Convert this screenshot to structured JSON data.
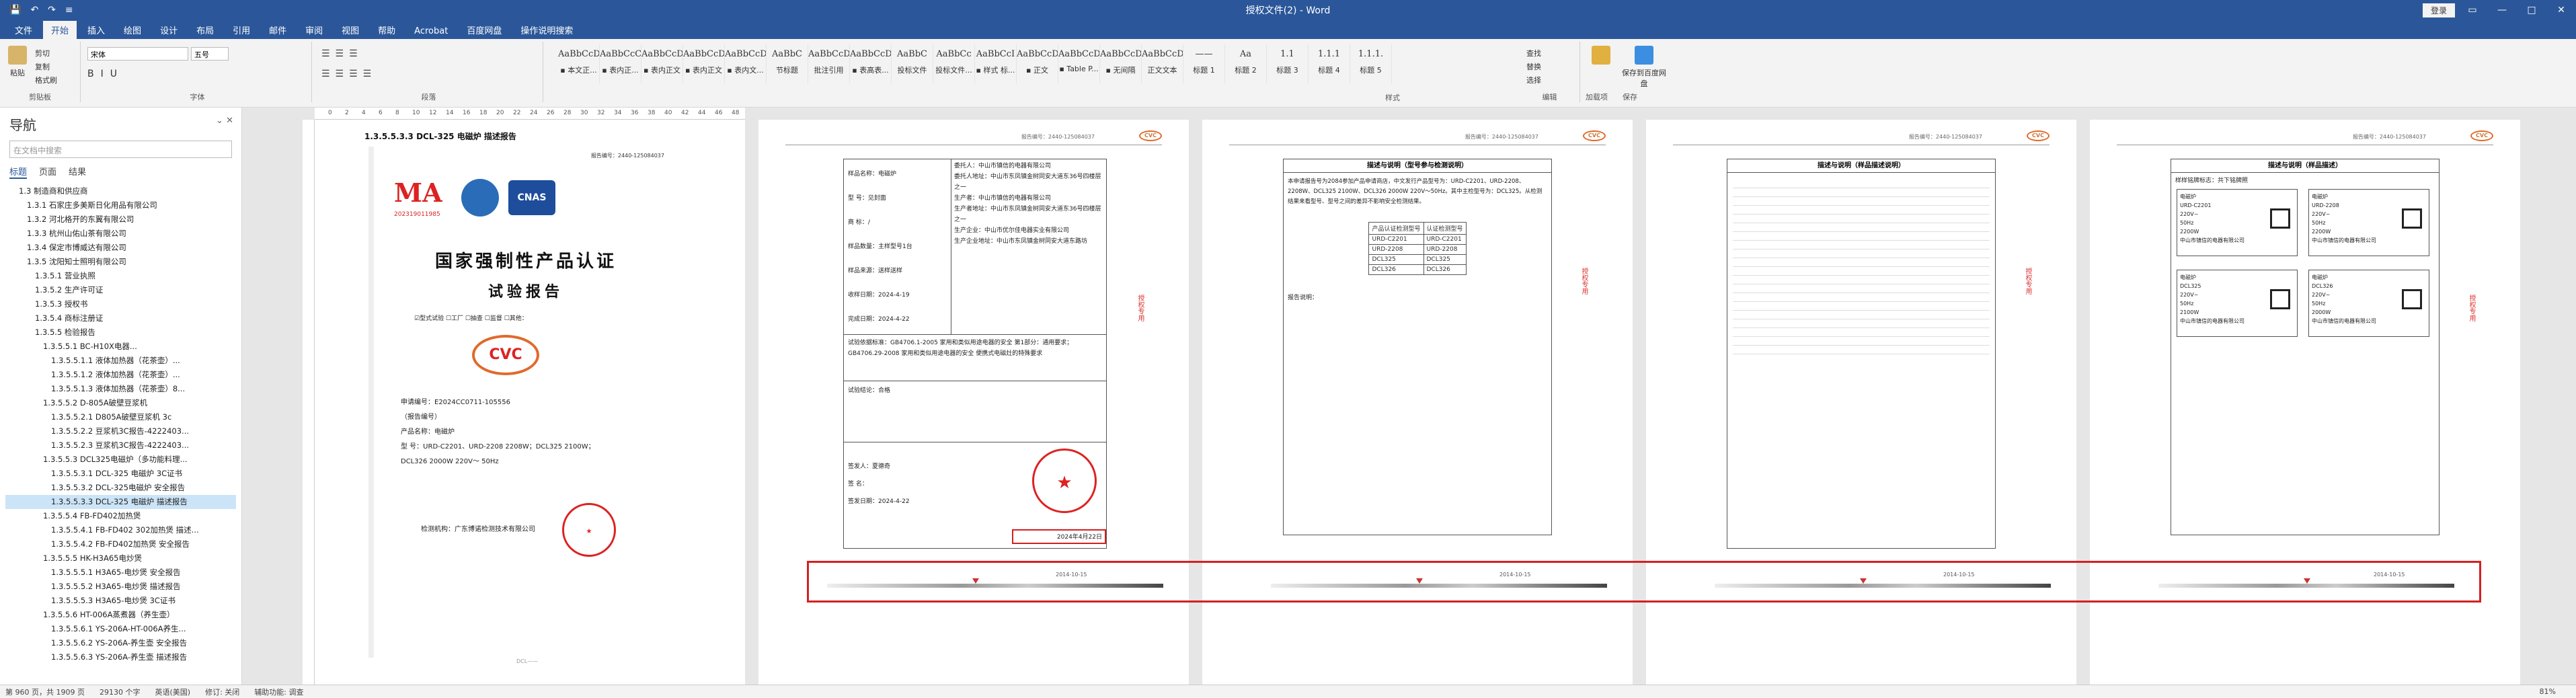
{
  "title_bar": {
    "quick_access": [
      "💾",
      "↶",
      "↷",
      "≡"
    ],
    "doc_title": "授权文件(2) - Word",
    "login": "登录",
    "win_buttons": [
      "▭",
      "—",
      "□",
      "✕"
    ]
  },
  "ribbon_tabs": [
    "文件",
    "开始",
    "插入",
    "绘图",
    "设计",
    "布局",
    "引用",
    "邮件",
    "审阅",
    "视图",
    "帮助",
    "Acrobat",
    "百度网盘",
    "操作说明搜索"
  ],
  "active_tab": "开始",
  "clipboard": {
    "paste": "粘贴",
    "cut": "剪切",
    "copy": "复制",
    "format_painter": "格式刷",
    "label": "剪贴板"
  },
  "font_group": {
    "font": "宋体",
    "size": "五号",
    "label": "字体"
  },
  "paragraph_label": "段落",
  "styles": [
    {
      "preview": "AaBbCcDd",
      "name": "▪ 本文正..."
    },
    {
      "preview": "AaBbCcC",
      "name": "▪ 表内正..."
    },
    {
      "preview": "AaBbCcDd",
      "name": "▪ 表内正文"
    },
    {
      "preview": "AaBbCcDd",
      "name": "▪ 表内正文"
    },
    {
      "preview": "AaBbCcDd",
      "name": "▪ 表内文..."
    },
    {
      "preview": "AaBbC",
      "name": "节标题"
    },
    {
      "preview": "AaBbCcDd",
      "name": "批注引用"
    },
    {
      "preview": "AaBbCcDd",
      "name": "▪ 表高表..."
    },
    {
      "preview": "AaBbC",
      "name": "投标文件"
    },
    {
      "preview": "AaBbCc",
      "name": "投标文件..."
    },
    {
      "preview": "AaBbCcI",
      "name": "▪ 样式 标..."
    },
    {
      "preview": "AaBbCcD",
      "name": "▪ 正文"
    },
    {
      "preview": "AaBbCcD",
      "name": "▪ Table P..."
    },
    {
      "preview": "AaBbCcD",
      "name": "▪ 无间隔"
    },
    {
      "preview": "AaBbCcD",
      "name": "正文文本"
    },
    {
      "preview": "——",
      "name": "标题 1"
    },
    {
      "preview": "Aa",
      "name": "标题 2"
    },
    {
      "preview": "1.1",
      "name": "标题 3"
    },
    {
      "preview": "1.1.1",
      "name": "标题 4"
    },
    {
      "preview": "1.1.1.",
      "name": "标题 5"
    }
  ],
  "styles_label": "样式",
  "editing": {
    "find": "查找",
    "replace": "替换",
    "select": "选择",
    "label": "编辑"
  },
  "addins": {
    "addin": "加载项",
    "baidu": "保存到百度网盘",
    "save": "保存"
  },
  "nav": {
    "title": "导航",
    "search_placeholder": "在文档中搜索",
    "tabs": [
      "标题",
      "页面",
      "结果"
    ],
    "items": [
      "1.3 制造商和供应商",
      "1.3.1 石家庄多美斯日化用品有限公司",
      "1.3.2 河北格开的东翼有限公司",
      "1.3.3 杭州山佑山茶有限公司",
      "1.3.4 保定市博威达有限公司",
      "1.3.5 沈阳知士照明有限公司",
      "1.3.5.1 营业执照",
      "1.3.5.2 生产许可证",
      "1.3.5.3 授权书",
      "1.3.5.4 商标注册证",
      "1.3.5.5 检验报告",
      "1.3.5.5.1 BC-H10X电器...",
      "1.3.5.5.1.1 液体加热器（花茶壶）...",
      "1.3.5.5.1.2 液体加热器（花茶壶）...",
      "1.3.5.5.1.3 液体加热器（花茶壶）8...",
      "1.3.5.5.2 D-805A破壁豆浆机",
      "1.3.5.5.2.1 D805A破壁豆浆机 3c",
      "1.3.5.5.2.2 豆浆机3C报告-4222403...",
      "1.3.5.5.2.3 豆浆机3C报告-4222403...",
      "1.3.5.5.3 DCL325电磁炉（多功能料理...",
      "1.3.5.5.3.1 DCL-325 电磁炉 3C证书",
      "1.3.5.5.3.2 DCL-325电磁炉 安全报告",
      "1.3.5.5.3.3 DCL-325 电磁炉 描述报告",
      "1.3.5.5.4 FB-FD402加热煲",
      "1.3.5.5.4.1 FB-FD402 302加热煲 描述...",
      "1.3.5.5.4.2 FB-FD402加热煲 安全报告",
      "1.3.5.5.5 HK-H3A65电炒煲",
      "1.3.5.5.5.1 H3A65-电炒煲 安全报告",
      "1.3.5.5.5.2 H3A65-电炒煲 描述报告",
      "1.3.5.5.5.3 H3A65-电炒煲 3C证书",
      "1.3.5.5.6 HT-006A蒸煮器（养生壶）",
      "1.3.5.5.6.1 YS-206A-HT-006A养生...",
      "1.3.5.5.6.2 YS-206A-养生壶 安全报告",
      "1.3.5.5.6.3 YS-206A-养生壶 描述报告"
    ],
    "selected_index": 22
  },
  "page1": {
    "heading": "1.3.5.5.3.3 DCL-325 电磁炉 描述报告",
    "report_no": "报告编号：2440-125084037",
    "main_title": "国家强制性产品认证",
    "sub_title": "试验报告",
    "checkboxes": "☑型式试验 ☐工厂 ☐抽查 ☐监督 ☐其他：",
    "fields": [
      "申请编号：E2024CC0711-105556",
      "（报告编号）",
      "产品名称：电磁炉",
      "型    号：URD-C2201、URD-2208  2208W；DCL325  2100W；",
      "DCL326  2000W  220V～ 50Hz"
    ],
    "lab": "检测机构：广东博诺检测技术有限公司",
    "cma_code": "202319011985",
    "mini_footer": "DCL——"
  },
  "page2": {
    "left_rows": [
      "样品名称：电磁炉",
      "型    号：见封面",
      "商    标：/",
      "样品数量：主样型号1台",
      "样品来源：送样送样",
      "收样日期：2024-4-19",
      "完成日期：2024-4-22"
    ],
    "right_rows": [
      "委托人：中山市镇信的电器有限公司",
      "委托人地址：中山市东凤镇金树同安大道东36号四楼层之一",
      "生产者：中山市镇信的电器有限公司",
      "生产者地址：中山市东凤镇金树同安大道东36号四楼层之一",
      "生产企业：中山市优尔佳电器实业有限公司",
      "生产企业地址：中山市东凤镇金树同安大道东路坊"
    ],
    "basis": "试验依据标准：GB4706.1-2005 家用和类似用途电器的安全 第1部分：通用要求；GB4706.29-2008 家用和类似用途电器的安全 便携式电磁灶的特殊要求",
    "conclusion": "试验结论：合格",
    "sign": [
      "签发人：夏德奇",
      "签    名：",
      "签发日期：2024-4-22"
    ],
    "date_box": "2024年4月22日"
  },
  "page3": {
    "title": "描述与说明（型号参与检测说明）",
    "intro": "本申请报告号为2084参加产品申请商店，中文发行产品型号为：URD-C2201、URD-2208、2208W、DCL325 2100W、DCL326 2000W 220V～50Hz。其中主检型号为：DCL325。从检测结果来看型号、型号之间的差异不影响安全检测结果。",
    "table_head": [
      "产品认证检测型号",
      "认证检测型号"
    ],
    "table_rows": [
      [
        "URD-C2201",
        "URD-C2201"
      ],
      [
        "URD-2208",
        "URD-2208"
      ],
      [
        "DCL325",
        "DCL325"
      ],
      [
        "DCL326",
        "DCL326"
      ]
    ],
    "notes_label": "报告说明："
  },
  "page4": {
    "title": "描述与说明（样品描述说明）"
  },
  "page5": {
    "title": "描述与说明（样品描述）",
    "label_title": "样样铭牌标志：共下铭牌照",
    "plates": [
      {
        "name": "电磁炉",
        "model": "URD-C2201",
        "volt": "220V~",
        "freq": "50Hz",
        "power": "2200W",
        "maker": "中山市镇信的电器有限公司"
      },
      {
        "name": "电磁炉",
        "model": "URD-2208",
        "volt": "220V~",
        "freq": "50Hz",
        "power": "2200W",
        "maker": "中山市镇信的电器有限公司"
      },
      {
        "name": "电磁炉",
        "model": "DCL325",
        "volt": "220V~",
        "freq": "50Hz",
        "power": "2100W",
        "maker": "中山市镇信的电器有限公司"
      },
      {
        "name": "电磁炉",
        "model": "DCL326",
        "volt": "220V~",
        "freq": "50Hz",
        "power": "2000W",
        "maker": "中山市镇信的电器有限公司"
      }
    ]
  },
  "timeline_date": "2014-10-15",
  "status": {
    "page": "第 960 页，共 1909 页",
    "words": "29130 个字",
    "lang": "英语(美国)",
    "track": "修订: 关闭",
    "access": "辅助功能: 调查",
    "zoom": "81%"
  }
}
